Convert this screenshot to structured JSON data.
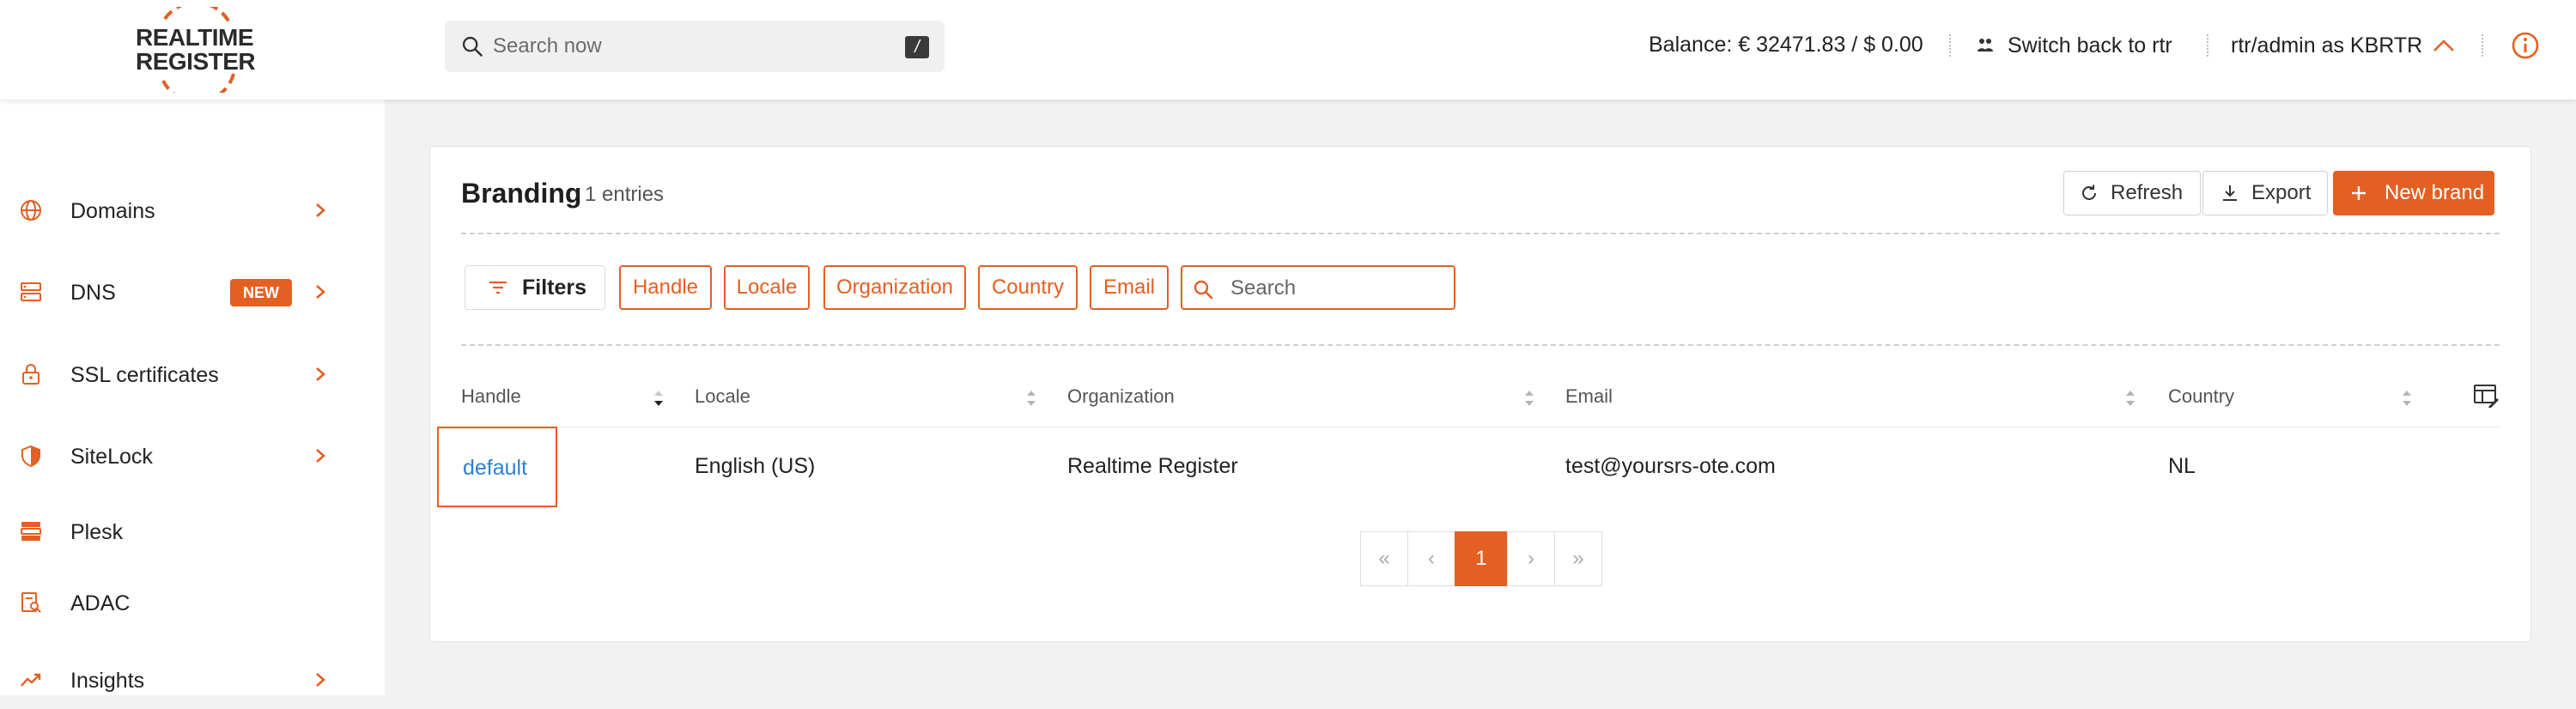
{
  "header": {
    "logo_line1": "REALTIME",
    "logo_line2": "REGISTER",
    "search_placeholder": "Search now",
    "search_shortcut": "/",
    "balance": "Balance: € 32471.83 / $ 0.00",
    "switch_label": "Switch back to rtr",
    "user_label": "rtr/admin as KBRTR",
    "icons": {
      "search": "search-icon",
      "switch": "switch-user-icon",
      "user_toggle": "chevron-up-icon",
      "info": "info-icon"
    }
  },
  "sidebar": {
    "items": [
      {
        "label": "Domains",
        "icon": "globe-icon",
        "has_chevron": true
      },
      {
        "label": "DNS",
        "icon": "server-icon",
        "badge": "NEW",
        "has_chevron": true
      },
      {
        "label": "SSL certificates",
        "icon": "lock-icon",
        "has_chevron": true
      },
      {
        "label": "SiteLock",
        "icon": "shield-icon",
        "has_chevron": true
      },
      {
        "label": "Plesk",
        "icon": "plesk-icon",
        "has_chevron": false
      },
      {
        "label": "ADAC",
        "icon": "report-search-icon",
        "has_chevron": false
      },
      {
        "label": "Insights",
        "icon": "trending-icon",
        "has_chevron": true
      }
    ]
  },
  "main": {
    "title": "Branding",
    "count": "1 entries",
    "actions": {
      "refresh": "Refresh",
      "export": "Export",
      "new_brand": "New brand"
    },
    "filters_label": "Filters",
    "filter_chips": [
      "Handle",
      "Locale",
      "Organization",
      "Country",
      "Email"
    ],
    "search_placeholder": "Search",
    "columns": [
      "Handle",
      "Locale",
      "Organization",
      "Email",
      "Country"
    ],
    "rows": [
      {
        "handle": "default",
        "locale": "English (US)",
        "organization": "Realtime Register",
        "email": "test@yoursrs-ote.com",
        "country": "NL"
      }
    ],
    "pagination": {
      "first": "«",
      "prev": "‹",
      "current": "1",
      "next": "›",
      "last": "»"
    }
  },
  "colors": {
    "accent": "#e45f22",
    "link": "#2f7fd6",
    "text": "#222222",
    "background": "#f2f2f2"
  }
}
